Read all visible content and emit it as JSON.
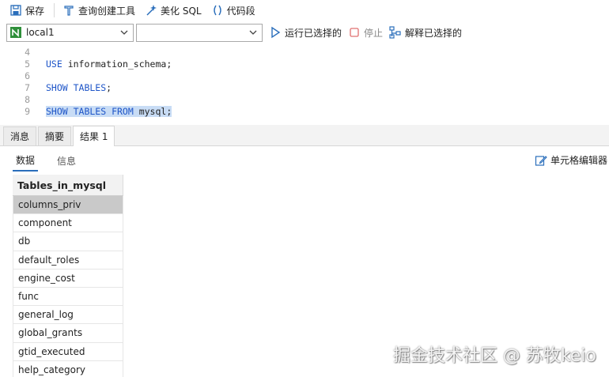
{
  "toolbar": {
    "save_label": "保存",
    "query_builder_label": "查询创建工具",
    "beautify_label": "美化 SQL",
    "snippet_label": "代码段"
  },
  "connection": {
    "selected": "local1",
    "database_selected": "",
    "run_selected_label": "运行已选择的",
    "stop_label": "停止",
    "explain_label": "解释已选择的"
  },
  "editor": {
    "lines": [
      {
        "num": "4",
        "text": ""
      },
      {
        "num": "5",
        "kw": "USE",
        "rest": " information_schema;"
      },
      {
        "num": "6",
        "text": ""
      },
      {
        "num": "7",
        "kw": "SHOW TABLES",
        "rest": ";"
      },
      {
        "num": "8",
        "text": ""
      },
      {
        "num": "9",
        "kw": "SHOW TABLES FROM",
        "rest": " mysql;"
      }
    ]
  },
  "result_tabs": [
    "消息",
    "摘要",
    "结果 1"
  ],
  "sub_tabs": [
    "数据",
    "信息"
  ],
  "cell_editor_label": "单元格编辑器",
  "grid": {
    "column": "Tables_in_mysql",
    "rows": [
      "columns_priv",
      "component",
      "db",
      "default_roles",
      "engine_cost",
      "func",
      "general_log",
      "global_grants",
      "gtid_executed",
      "help_category"
    ]
  },
  "watermark": "掘金技术社区 @ 苏牧keio",
  "colors": {
    "keyword": "#1e55c8",
    "selection": "#c8dcf5",
    "accent": "#2a6ebb"
  }
}
